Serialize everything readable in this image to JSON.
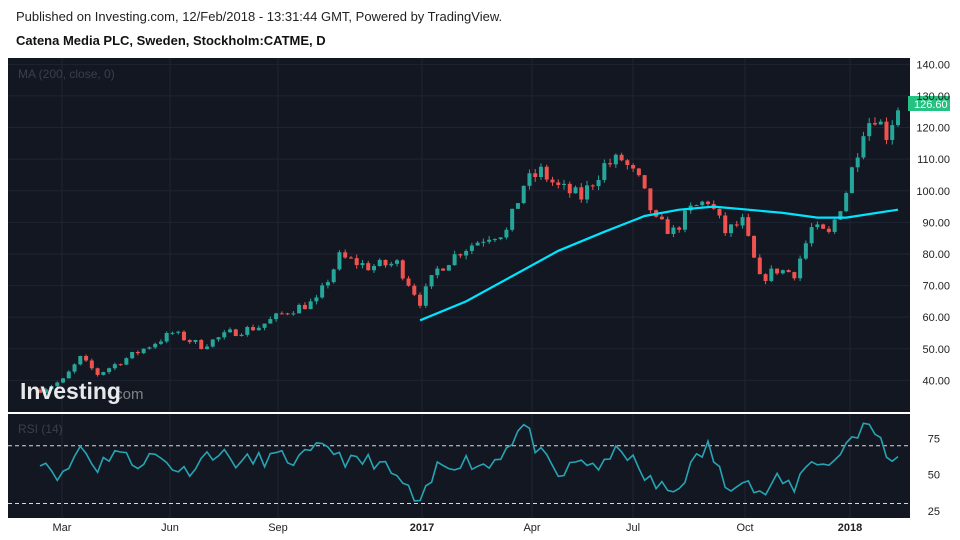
{
  "header": {
    "published": "Published on Investing.com, 12/Feb/2018 - 13:31:44 GMT, Powered by TradingView.",
    "title": "Catena Media PLC, Sweden, Stockholm:CATME, D"
  },
  "watermark": {
    "brand": "Investing",
    "suffix": ".com"
  },
  "colors": {
    "background": "#131722",
    "up": "#26a69a",
    "down": "#ef5350",
    "ma": "#00e5ff",
    "rsi": "#26a4b3",
    "price_tag": "#26c281",
    "axis_text": "#222222"
  },
  "chart_data": [
    {
      "type": "candlestick",
      "title": "Catena Media PLC, Sweden, Stockholm:CATME, D",
      "indicator_label": "MA (200, close, 0)",
      "ylim": [
        30,
        142
      ],
      "y_ticks": [
        40,
        50,
        60,
        70,
        80,
        90,
        100,
        110,
        120,
        130,
        140
      ],
      "y_tick_labels": [
        "40.00",
        "50.00",
        "60.00",
        "70.00",
        "80.00",
        "90.00",
        "100.00",
        "110.00",
        "120.00",
        "130.00",
        "140.00"
      ],
      "x_ticks": [
        "Mar",
        "Jun",
        "Sep",
        "2017",
        "Apr",
        "Jul",
        "Oct",
        "2018"
      ],
      "last_price": "126.60",
      "price_path": [
        [
          0,
          37
        ],
        [
          4,
          40
        ],
        [
          7,
          47
        ],
        [
          10,
          42
        ],
        [
          13,
          45
        ],
        [
          18,
          50
        ],
        [
          23,
          55
        ],
        [
          28,
          51
        ],
        [
          33,
          55
        ],
        [
          38,
          57
        ],
        [
          43,
          62
        ],
        [
          48,
          65
        ],
        [
          52,
          79
        ],
        [
          57,
          76
        ],
        [
          62,
          77
        ],
        [
          66,
          65
        ],
        [
          69,
          75
        ],
        [
          73,
          81
        ],
        [
          78,
          86
        ],
        [
          81,
          87
        ],
        [
          84,
          102
        ],
        [
          87,
          106
        ],
        [
          90,
          101
        ],
        [
          94,
          98
        ],
        [
          98,
          108
        ],
        [
          101,
          110
        ],
        [
          104,
          103
        ],
        [
          107,
          90
        ],
        [
          110,
          87
        ],
        [
          113,
          94
        ],
        [
          116,
          97
        ],
        [
          119,
          87
        ],
        [
          122,
          90
        ],
        [
          125,
          72
        ],
        [
          128,
          75
        ],
        [
          131,
          74
        ],
        [
          134,
          88
        ],
        [
          137,
          86
        ],
        [
          140,
          100
        ],
        [
          143,
          120
        ],
        [
          145,
          124
        ],
        [
          147,
          118
        ],
        [
          149,
          126.6
        ]
      ],
      "ma_series": {
        "name": "MA (200, close, 0)",
        "points": [
          [
            66,
            59
          ],
          [
            74,
            65
          ],
          [
            82,
            73
          ],
          [
            90,
            81
          ],
          [
            98,
            87
          ],
          [
            105,
            92
          ],
          [
            111,
            94
          ],
          [
            117,
            95
          ],
          [
            123,
            94
          ],
          [
            129,
            93
          ],
          [
            135,
            91.5
          ],
          [
            140,
            91.5
          ],
          [
            149,
            94
          ]
        ]
      }
    },
    {
      "type": "line",
      "indicator_label": "RSI (14)",
      "ylim": [
        20,
        92
      ],
      "y_ticks": [
        25,
        50,
        75
      ],
      "y_tick_labels": [
        "25",
        "50",
        "75"
      ],
      "reference_lines": [
        70,
        30
      ],
      "rsi_path": [
        [
          0,
          62
        ],
        [
          4,
          48
        ],
        [
          7,
          70
        ],
        [
          10,
          55
        ],
        [
          13,
          68
        ],
        [
          16,
          58
        ],
        [
          20,
          63
        ],
        [
          25,
          52
        ],
        [
          30,
          66
        ],
        [
          35,
          58
        ],
        [
          40,
          62
        ],
        [
          45,
          60
        ],
        [
          50,
          70
        ],
        [
          54,
          58
        ],
        [
          58,
          60
        ],
        [
          63,
          44
        ],
        [
          66,
          27
        ],
        [
          69,
          55
        ],
        [
          73,
          60
        ],
        [
          78,
          56
        ],
        [
          81,
          70
        ],
        [
          84,
          84
        ],
        [
          87,
          63
        ],
        [
          90,
          48
        ],
        [
          94,
          60
        ],
        [
          98,
          55
        ],
        [
          101,
          70
        ],
        [
          104,
          52
        ],
        [
          107,
          42
        ],
        [
          110,
          38
        ],
        [
          113,
          55
        ],
        [
          116,
          70
        ],
        [
          119,
          42
        ],
        [
          122,
          50
        ],
        [
          125,
          35
        ],
        [
          128,
          45
        ],
        [
          131,
          42
        ],
        [
          134,
          62
        ],
        [
          137,
          55
        ],
        [
          140,
          72
        ],
        [
          143,
          84
        ],
        [
          146,
          75
        ],
        [
          148,
          56
        ],
        [
          149,
          64
        ]
      ]
    }
  ]
}
